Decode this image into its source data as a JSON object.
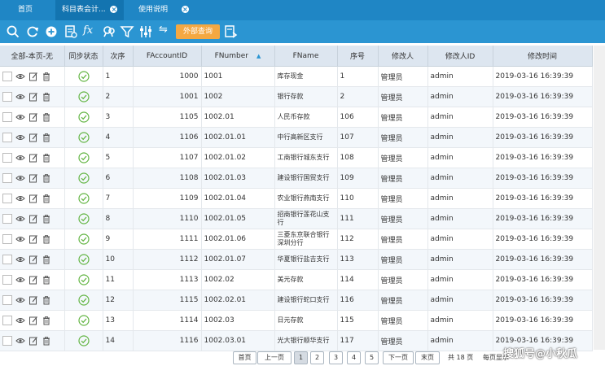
{
  "tabs": [
    {
      "label": "首页",
      "closable": false
    },
    {
      "label": "科目表会计...",
      "closable": true
    },
    {
      "label": "使用说明",
      "closable": true
    }
  ],
  "toolbar": {
    "icons": [
      "search-icon",
      "refresh-icon",
      "add-icon",
      "report-icon",
      "formula-icon",
      "filter-alt-icon",
      "filter-icon",
      "column-settings-icon",
      "swap-icon",
      "export-icon"
    ],
    "fx_label": "fx",
    "external_query_label": "外部查询",
    "accent_color": "#f4a842"
  },
  "table": {
    "headers": [
      "全部-本页-无",
      "同步状态",
      "次序",
      "FAccountID",
      "FNumber",
      "FName",
      "序号",
      "修改人",
      "修改人ID",
      "修改时间"
    ],
    "rows": [
      {
        "order": "1",
        "id": "1000",
        "number": "1001",
        "name": "库存现金",
        "seq": "1",
        "modifier": "管理员",
        "modifier_id": "admin",
        "time": "2019-03-16 16:39:39"
      },
      {
        "order": "2",
        "id": "1001",
        "number": "1002",
        "name": "银行存款",
        "seq": "2",
        "modifier": "管理员",
        "modifier_id": "admin",
        "time": "2019-03-16 16:39:39"
      },
      {
        "order": "3",
        "id": "1105",
        "number": "1002.01",
        "name": "人民币存款",
        "seq": "106",
        "modifier": "管理员",
        "modifier_id": "admin",
        "time": "2019-03-16 16:39:39"
      },
      {
        "order": "4",
        "id": "1106",
        "number": "1002.01.01",
        "name": "中行高新区支行",
        "seq": "107",
        "modifier": "管理员",
        "modifier_id": "admin",
        "time": "2019-03-16 16:39:39"
      },
      {
        "order": "5",
        "id": "1107",
        "number": "1002.01.02",
        "name": "工商银行城东支行",
        "seq": "108",
        "modifier": "管理员",
        "modifier_id": "admin",
        "time": "2019-03-16 16:39:39"
      },
      {
        "order": "6",
        "id": "1108",
        "number": "1002.01.03",
        "name": "建设银行国贸支行",
        "seq": "109",
        "modifier": "管理员",
        "modifier_id": "admin",
        "time": "2019-03-16 16:39:39"
      },
      {
        "order": "7",
        "id": "1109",
        "number": "1002.01.04",
        "name": "农业银行燕南支行",
        "seq": "110",
        "modifier": "管理员",
        "modifier_id": "admin",
        "time": "2019-03-16 16:39:39"
      },
      {
        "order": "8",
        "id": "1110",
        "number": "1002.01.05",
        "name": "招商银行莲花山支行",
        "seq": "111",
        "modifier": "管理员",
        "modifier_id": "admin",
        "time": "2019-03-16 16:39:39"
      },
      {
        "order": "9",
        "id": "1111",
        "number": "1002.01.06",
        "name": "三菱东京联合银行深圳分行",
        "seq": "112",
        "modifier": "管理员",
        "modifier_id": "admin",
        "time": "2019-03-16 16:39:39"
      },
      {
        "order": "10",
        "id": "1112",
        "number": "1002.01.07",
        "name": "华夏银行盐吉支行",
        "seq": "113",
        "modifier": "管理员",
        "modifier_id": "admin",
        "time": "2019-03-16 16:39:39"
      },
      {
        "order": "11",
        "id": "1113",
        "number": "1002.02",
        "name": "美元存款",
        "seq": "114",
        "modifier": "管理员",
        "modifier_id": "admin",
        "time": "2019-03-16 16:39:39"
      },
      {
        "order": "12",
        "id": "1115",
        "number": "1002.02.01",
        "name": "建设银行蛇口支行",
        "seq": "116",
        "modifier": "管理员",
        "modifier_id": "admin",
        "time": "2019-03-16 16:39:39"
      },
      {
        "order": "13",
        "id": "1114",
        "number": "1002.03",
        "name": "日元存款",
        "seq": "115",
        "modifier": "管理员",
        "modifier_id": "admin",
        "time": "2019-03-16 16:39:39"
      },
      {
        "order": "14",
        "id": "1116",
        "number": "1002.03.01",
        "name": "光大银行顺华支行",
        "seq": "117",
        "modifier": "管理员",
        "modifier_id": "admin",
        "time": "2019-03-16 16:39:39"
      }
    ]
  },
  "pager": {
    "first": "首页",
    "prev": "上一页",
    "pages": [
      "1",
      "2",
      "3",
      "4",
      "5"
    ],
    "current": "1",
    "next": "下一页",
    "last": "末页",
    "total": "共 18 页",
    "per_page": "每页显示"
  },
  "watermark": "搜狐号@小秋瓜"
}
